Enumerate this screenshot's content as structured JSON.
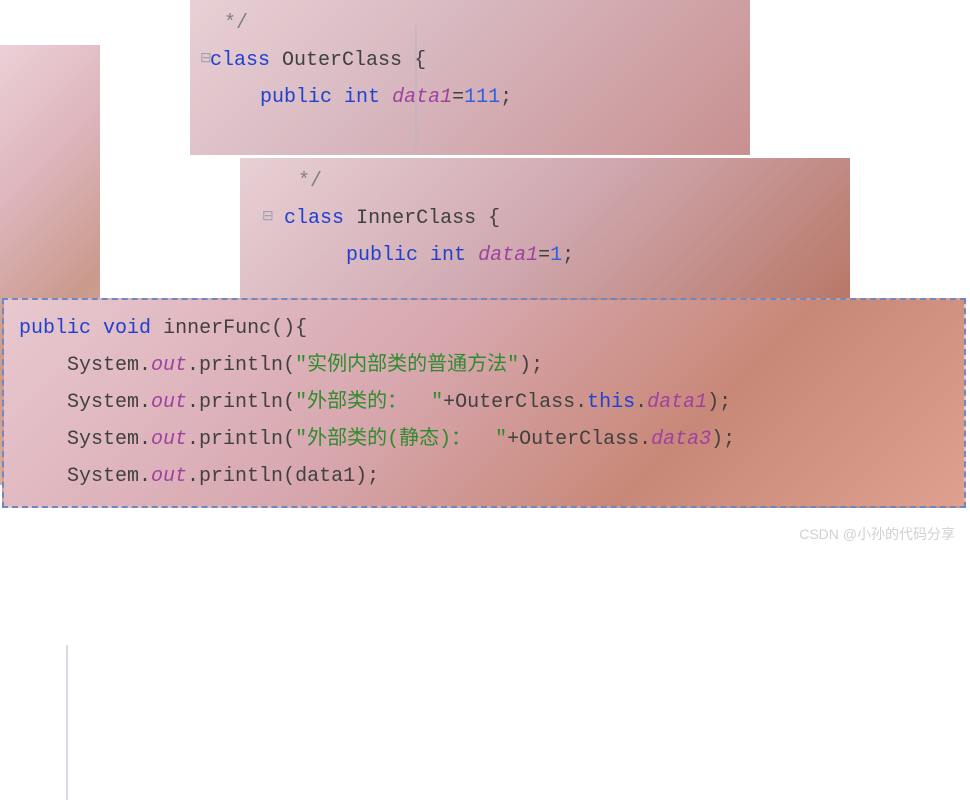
{
  "block1": {
    "comment_close": "*/",
    "line1": {
      "kw": "class",
      "name": "OuterClass",
      "brace": "{"
    },
    "line2": {
      "kw": "public",
      "type": "int",
      "var": "data1",
      "eq": "=",
      "val": "111",
      "semi": ";"
    }
  },
  "block2": {
    "comment_close": "*/",
    "line1": {
      "kw": "class",
      "name": "InnerClass",
      "brace": "{"
    },
    "line2": {
      "kw": "public",
      "type": "int",
      "var": "data1",
      "eq": "=",
      "val": "1",
      "semi": ";"
    }
  },
  "block3": {
    "sig": {
      "kw1": "public",
      "kw2": "void",
      "name": "innerFunc",
      "parens": "()",
      "brace": "{"
    },
    "l1": {
      "a": "System.",
      "b": "out",
      "c": ".println(",
      "s": "\"实例内部类的普通方法\"",
      "d": ");"
    },
    "l2": {
      "a": "System.",
      "b": "out",
      "c": ".println(",
      "s": "\"外部类的：  \"",
      "plus": "+OuterClass.",
      "th": "this",
      "dot": ".",
      "f": "data1",
      "d": ");"
    },
    "l3": {
      "a": "System.",
      "b": "out",
      "c": ".println(",
      "s": "\"外部类的(静态)：  \"",
      "plus": "+OuterClass.",
      "f": "data3",
      "d": ");"
    },
    "l4": {
      "a": "System.",
      "b": "out",
      "c": ".println(data1);"
    }
  },
  "watermark": "CSDN @小孙的代码分享"
}
